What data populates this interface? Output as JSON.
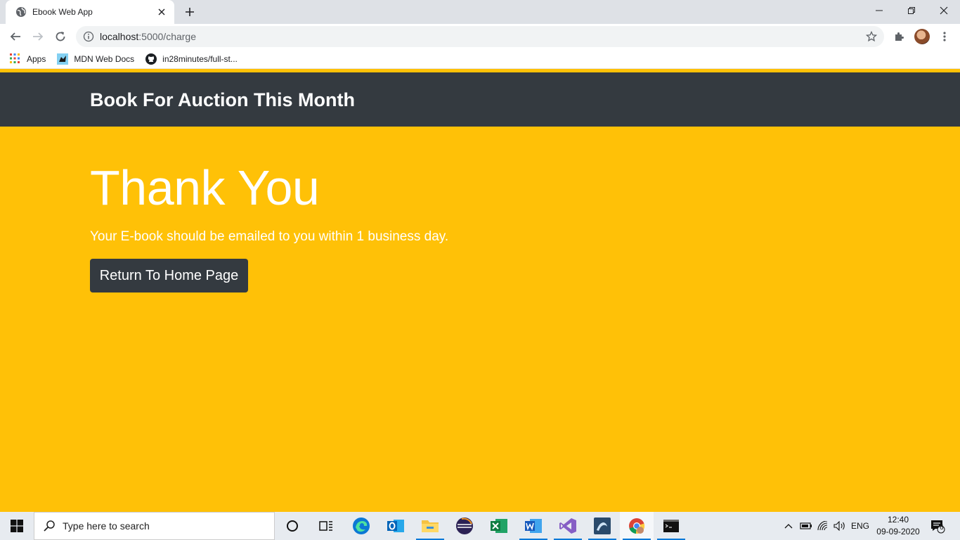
{
  "browser": {
    "tab": {
      "title": "Ebook Web App",
      "favicon": "globe-icon",
      "close": "close-icon"
    },
    "new_tab": "plus-icon",
    "window_controls": [
      "minimize-icon",
      "restore-icon",
      "close-icon"
    ],
    "url": {
      "host": "localhost",
      "path": ":5000/charge"
    },
    "bookmarks": [
      {
        "label": "Apps",
        "icon": "apps-grid-icon"
      },
      {
        "label": "MDN Web Docs",
        "icon": "mdn-icon"
      },
      {
        "label": "in28minutes/full-st...",
        "icon": "github-icon"
      }
    ]
  },
  "page": {
    "navbar": {
      "brand": "Book For Auction This Month"
    },
    "jumbotron": {
      "heading": "Thank You",
      "lead": "Your E-book should be emailed to you within 1 business day.",
      "button_label": "Return To Home Page"
    },
    "colors": {
      "navbar": "#343a40",
      "jumbotron": "#ffc107",
      "button": "#343a40"
    }
  },
  "taskbar": {
    "search_placeholder": "Type here to search",
    "apps": [
      "cortana-icon",
      "task-view-icon",
      "edge-icon",
      "outlook-icon",
      "file-explorer-icon",
      "eclipse-icon",
      "excel-icon",
      "word-icon",
      "visual-studio-icon",
      "mysql-workbench-icon",
      "chrome-icon",
      "terminal-icon"
    ],
    "language": "ENG",
    "time": "12:40",
    "date": "09-09-2020",
    "notifications": "6"
  }
}
